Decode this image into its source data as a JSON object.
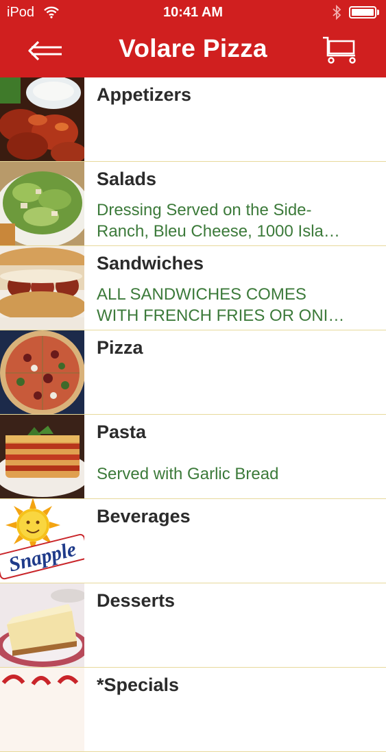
{
  "status": {
    "carrier": "iPod",
    "time": "10:41 AM"
  },
  "nav": {
    "title": "Volare Pizza",
    "back_icon": "back-arrow-icon",
    "cart_icon": "cart-icon"
  },
  "colors": {
    "nav_bg": "#d01f1f",
    "description_text": "#3c7a3a",
    "divider": "#e7d99a"
  },
  "categories": [
    {
      "title": "Appetizers",
      "desc1": "",
      "desc2": "",
      "image": "chicken-wings"
    },
    {
      "title": "Salads",
      "desc1": "Dressing Served on the Side-",
      "desc2": "Ranch, Bleu Cheese, 1000 Isla…",
      "image": "caesar-salad"
    },
    {
      "title": "Sandwiches",
      "desc1": "ALL SANDWICHES COMES",
      "desc2": "WITH FRENCH FRIES OR ONI…",
      "image": "meatball-sub"
    },
    {
      "title": "Pizza",
      "desc1": "",
      "desc2": "",
      "image": "pizza"
    },
    {
      "title": "Pasta",
      "desc1": "Served with Garlic Bread",
      "desc2": "",
      "image": "lasagna"
    },
    {
      "title": "Beverages",
      "desc1": "",
      "desc2": "",
      "image": "snapple-logo",
      "logo_text": "Snapple"
    },
    {
      "title": "Desserts",
      "desc1": "",
      "desc2": "",
      "image": "cheesecake"
    },
    {
      "title": "*Specials",
      "desc1": "",
      "desc2": "",
      "image": "specials"
    }
  ]
}
